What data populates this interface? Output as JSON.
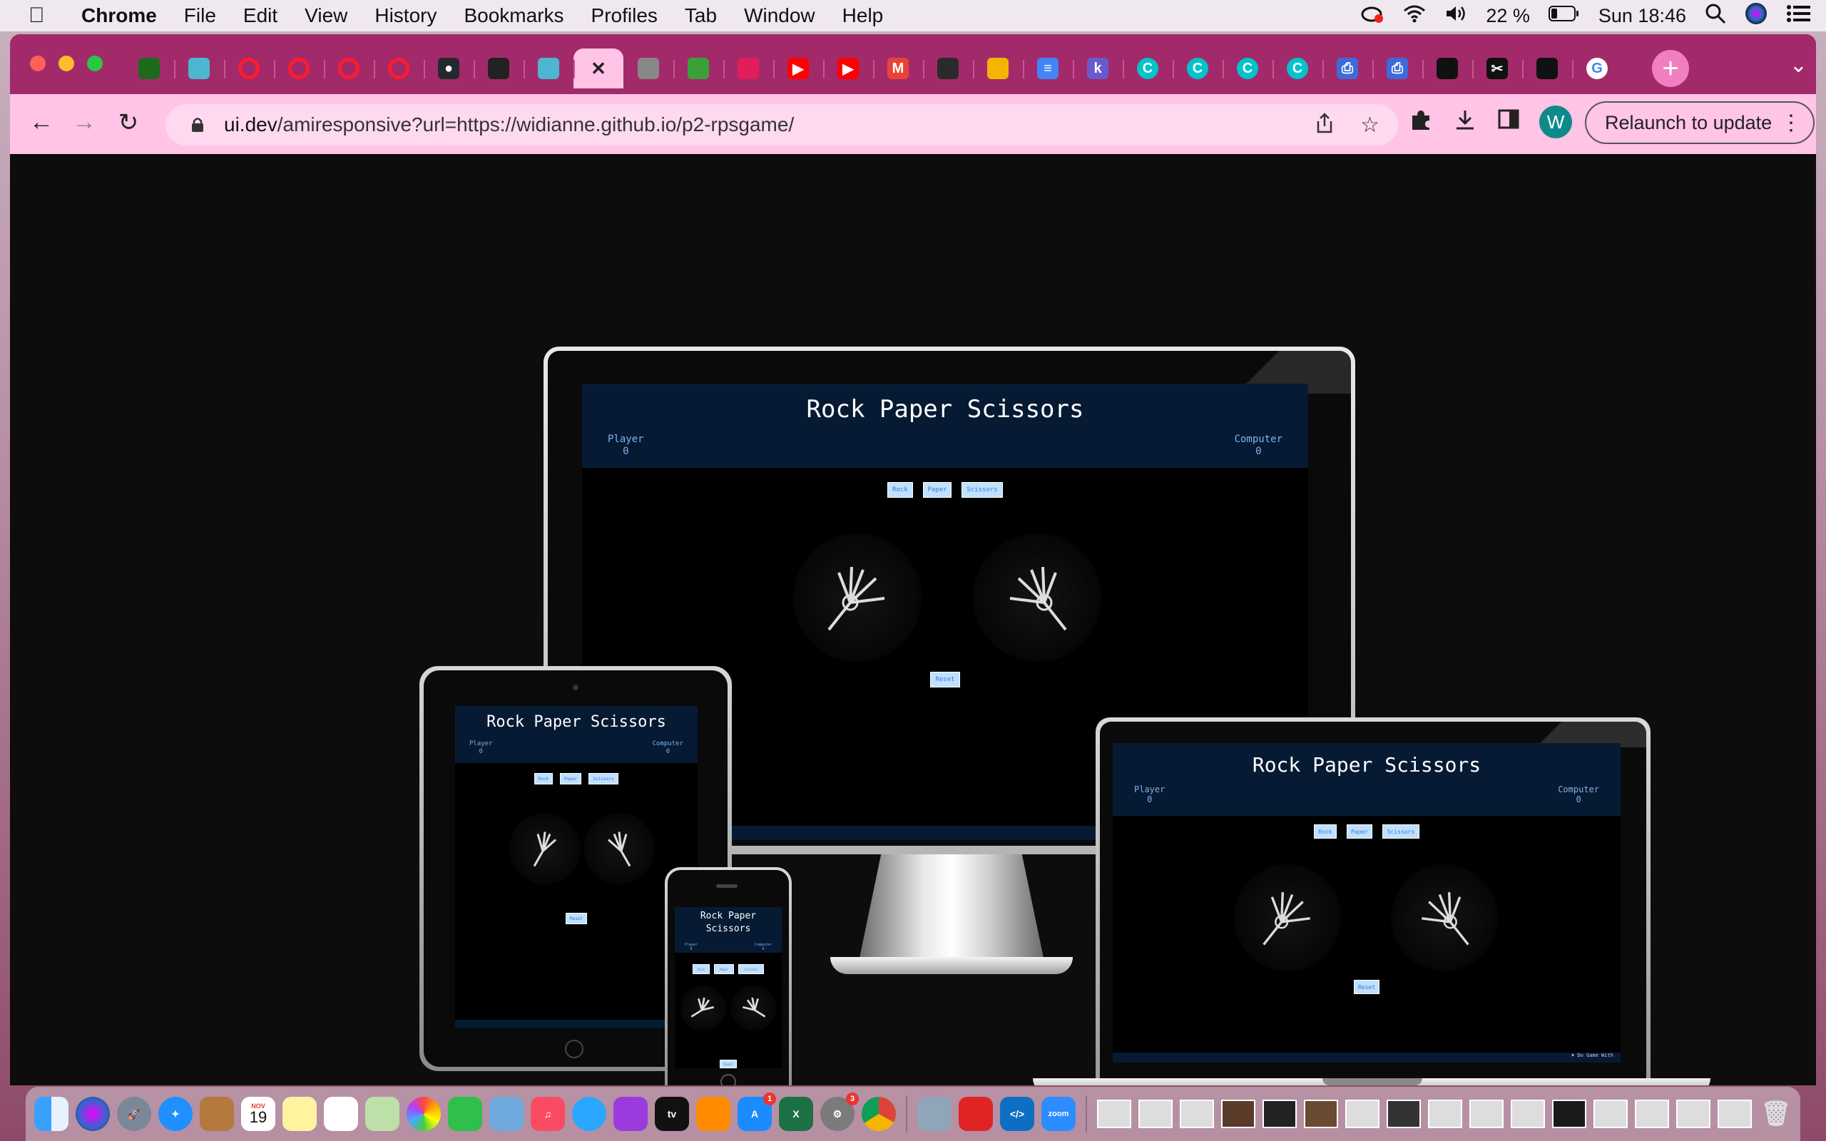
{
  "menubar": {
    "app_name": "Chrome",
    "menus": [
      "File",
      "Edit",
      "View",
      "History",
      "Bookmarks",
      "Profiles",
      "Tab",
      "Window",
      "Help"
    ],
    "battery": "22 %",
    "clock": "Sun 18:46"
  },
  "browser": {
    "tab_favicons": [
      "vuetify",
      "cloud-fish",
      "opera",
      "opera",
      "opera",
      "opera",
      "github",
      "dice",
      "cloud-fish",
      "close-active",
      "globe",
      "frog",
      "slack",
      "youtube",
      "youtube",
      "gmail",
      "cursor",
      "drive",
      "docs",
      "k",
      "canva",
      "canva",
      "canva",
      "canva",
      "print",
      "print",
      "unsplash",
      "scissors",
      "unsplash",
      "google"
    ],
    "url_host": "ui.dev",
    "url_path": "/amiresponsive?url=https://widianne.github.io/p2-rpsgame/",
    "profile_initial": "W",
    "relaunch_label": "Relaunch to update"
  },
  "game": {
    "title": "Rock Paper Scissors",
    "player_label": "Player",
    "player_score": "0",
    "computer_label": "Computer",
    "computer_score": "0",
    "buttons": [
      "Rock",
      "Paper",
      "Scissors"
    ],
    "reset_label": "Reset",
    "footer_text": "♦ Do Game With"
  },
  "dock": {
    "calendar_month": "NOV",
    "calendar_day": "19",
    "appstore_badge": "1",
    "settings_badge": "3",
    "appletv_label": "tv",
    "zoom_label": "zoom"
  }
}
